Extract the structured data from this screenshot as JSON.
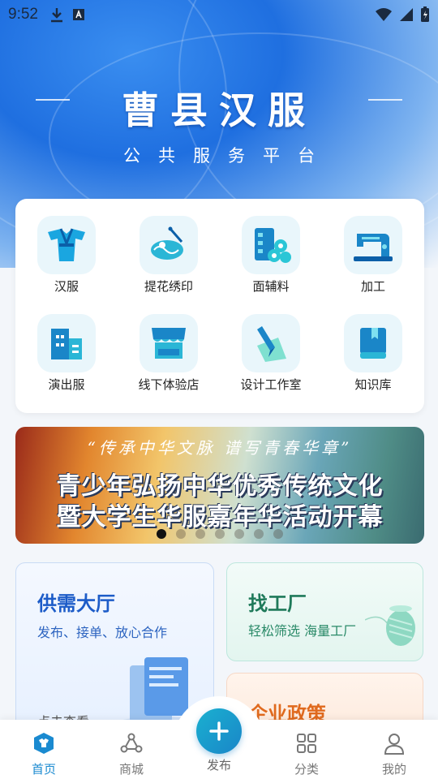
{
  "status_bar": {
    "time": "9:52"
  },
  "header": {
    "title": "曹县汉服",
    "subtitle": "公共服务平台"
  },
  "service_grid": [
    {
      "label": "汉服",
      "icon": "hanfu-robe-icon"
    },
    {
      "label": "提花绣印",
      "icon": "embroidery-icon"
    },
    {
      "label": "面辅料",
      "icon": "fabric-materials-icon"
    },
    {
      "label": "加工",
      "icon": "sewing-machine-icon"
    },
    {
      "label": "演出服",
      "icon": "building-icon"
    },
    {
      "label": "线下体验店",
      "icon": "storefront-icon"
    },
    {
      "label": "设计工作室",
      "icon": "design-tools-icon"
    },
    {
      "label": "知识库",
      "icon": "book-icon"
    }
  ],
  "banner": {
    "quote": "“传承中华文脉 谱写青春华章”",
    "line1": "青少年弘扬中华优秀传统文化",
    "line2": "暨大学生华服嘉年华活动开幕",
    "slide_count": 7,
    "active_slide": 1
  },
  "cards": {
    "supply_demand": {
      "title": "供需大厅",
      "subtitle": "发布、接单、放心合作",
      "cta": "点击查看"
    },
    "find_factory": {
      "title": "找工厂",
      "subtitle": "轻松筛选 海量工厂"
    },
    "enterprise_policy": {
      "title": "企业政策"
    }
  },
  "tabbar": {
    "home": "首页",
    "mall": "商城",
    "publish": "发布",
    "category": "分类",
    "mine": "我的"
  },
  "colors": {
    "accent": "#1a8ad0",
    "hero_blue": "#1f6fe0"
  }
}
